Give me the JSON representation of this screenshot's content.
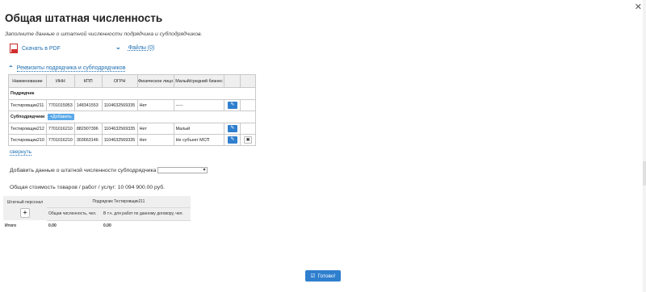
{
  "dialog": {
    "title": "Общая штатная численность",
    "subtitle": "Заполните данные о штатной численности подрядчика и субподрядчиков."
  },
  "links": {
    "pdf": "Скачать в PDF",
    "files": "Файлы (0)",
    "requisites": "Реквизиты подрядчика и субподрядчиков",
    "collapse": "свернуть"
  },
  "requisites_table": {
    "headers": [
      "Наименование",
      "ИНН",
      "КПП",
      "ОГРН",
      "Физическое лицо",
      "Малый/средний бизнес"
    ],
    "contractor_label": "Подрядчик",
    "subcontractors_label": "Субподрядчики",
    "add_label": "Добавить",
    "contractor_row": [
      "Тестировщик211",
      "7701015953",
      "148341553",
      "1104632569335",
      "Нет",
      "-----"
    ],
    "sub_rows": [
      [
        "Тестировщик212",
        "7701016210",
        "882907396",
        "1104632569335",
        "Нет",
        "Малый"
      ],
      [
        "Тестировщик210",
        "7701016210",
        "303663146",
        "1104632569335",
        "Нет",
        "Не субъект МСП"
      ]
    ]
  },
  "add_staff": {
    "label": "Добавить данные о штатной численности субподрядчика",
    "selected": ""
  },
  "cost": "Общая стоимость товаров / работ / услуг: 10 094 900.00 руб.",
  "staff_table": {
    "staff_label": "Штатный персонал",
    "contractor_header": "Подрядчик Тестировщик211",
    "col1": "Общая численность, чел.",
    "col2": "В т.ч. для работ по данному договору, чел.",
    "total_label": "Итого",
    "total1": "0.00",
    "total2": "0.00"
  },
  "done_label": "Готово!",
  "colors": {
    "accent": "#2f7fcf",
    "link": "#1f6fb2"
  }
}
